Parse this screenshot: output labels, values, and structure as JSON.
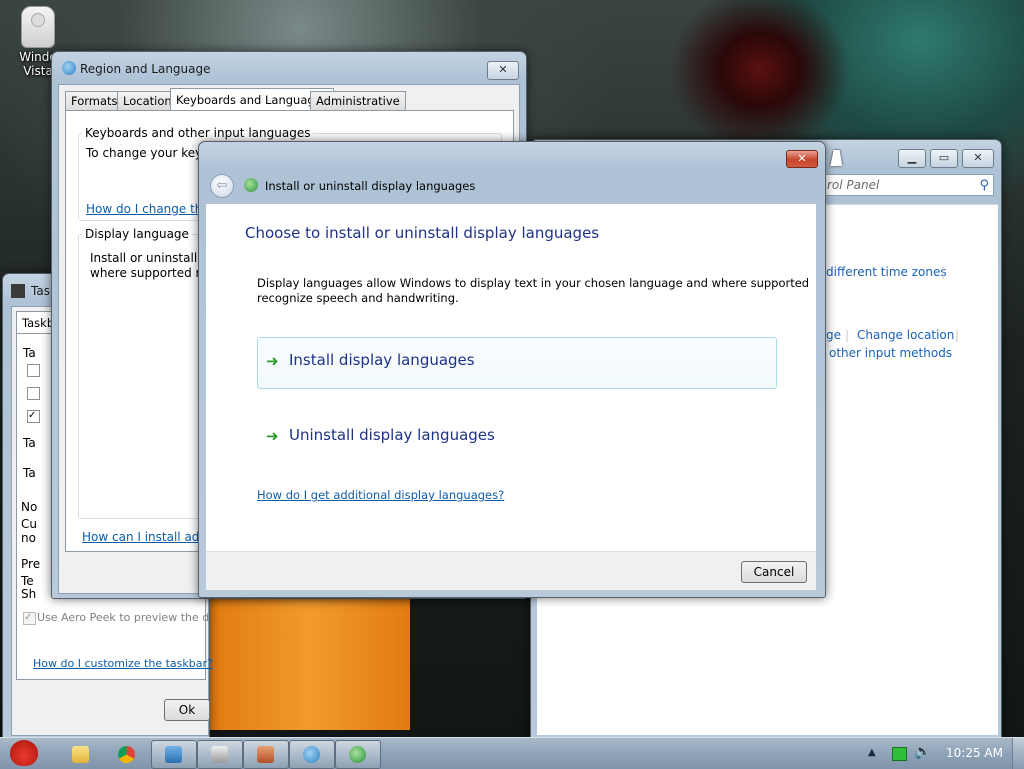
{
  "desktop": {
    "icon_label_line1": "Windo",
    "icon_label_line2": "Vista"
  },
  "region_window": {
    "title": "Region and Language",
    "tabs": [
      "Formats",
      "Location",
      "Keyboards and Languages",
      "Administrative"
    ],
    "active_tab": 2,
    "keyboards_group": "Keyboards and other input languages",
    "keyboards_text": "To change your keyb",
    "keyboards_link": "How do I change the",
    "display_group": "Display language",
    "display_text_1": "Install or uninstall la",
    "display_text_2": "where supported rec",
    "bottom_link": "How can I install additi"
  },
  "control_panel": {
    "search_text": "rol Panel",
    "link_timezones": "different time zones",
    "link_ge": "ge",
    "link_change_location": "Change location",
    "link_other_input": "other input methods"
  },
  "taskbar_props": {
    "title": "Task",
    "tab": "Taskb",
    "labels": [
      "Ta",
      "Ta",
      "Ta",
      "No",
      "Cu",
      "no",
      "Pre",
      "Te",
      "Sh"
    ],
    "aero_peek": "Use Aero Peek to preview the d",
    "help_link": "How do I customize the taskbar?",
    "ok": "Ok"
  },
  "dialog": {
    "title": "Install or uninstall display languages",
    "heading": "Choose to install or uninstall display languages",
    "description_1": "Display languages allow Windows to display text in your chosen language and where supported",
    "description_2": "recognize speech and handwriting.",
    "option_install": "Install display languages",
    "option_uninstall": "Uninstall display languages",
    "help_link": "How do I get additional display languages?",
    "cancel": "Cancel",
    "close_symbol": "✕"
  },
  "taskbar": {
    "clock": "10:25 AM",
    "buttons": [
      "start",
      "explorer",
      "chrome",
      "app",
      "taskbar-props",
      "tool",
      "control-panel",
      "language"
    ]
  },
  "colors": {
    "link": "#0f5ca8",
    "heading": "#1e3287",
    "arrow": "#2b9a2b"
  }
}
